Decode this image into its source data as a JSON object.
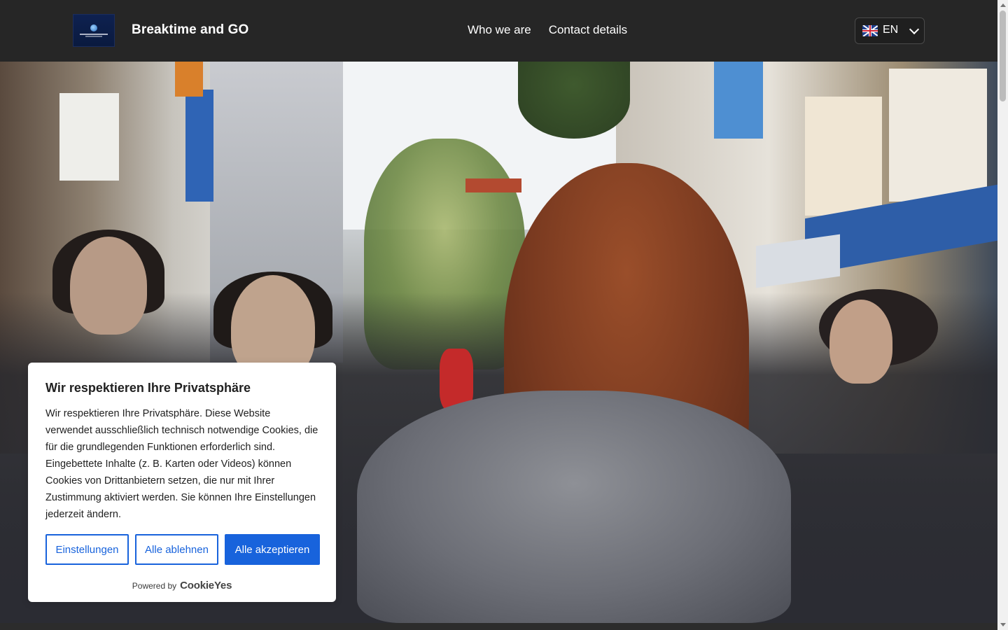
{
  "header": {
    "brand": "Breaktime and GO",
    "logo_alt": "Breaktime & GO logo",
    "nav": [
      "Who we are",
      "Contact details"
    ],
    "language": {
      "code": "EN",
      "flag": "uk-flag-icon"
    }
  },
  "cookie_banner": {
    "title": "Wir respektieren Ihre Privatsphäre",
    "text": "Wir respektieren Ihre Privatsphäre. Diese Website verwendet ausschließlich technisch notwendige Cookies, die für die grundlegenden Funktionen erforderlich sind. Eingebettete Inhalte (z. B. Karten oder Videos) können Cookies von Drittanbietern setzen, die nur mit Ihrer Zustimmung aktiviert werden. Sie können Ihre Einstellungen jederzeit ändern.",
    "buttons": {
      "settings": "Einstellungen",
      "reject": "Alle ablehnen",
      "accept": "Alle akzeptieren"
    },
    "powered_by_label": "Powered by",
    "powered_by_brand": "CookieYes"
  },
  "colors": {
    "header_bg": "#262626",
    "accent": "#1863dc",
    "banner_bg": "#ffffff"
  }
}
